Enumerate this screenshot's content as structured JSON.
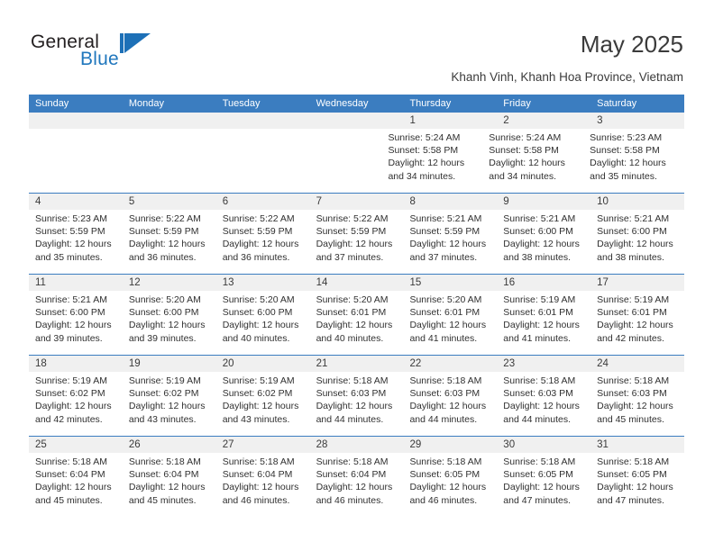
{
  "brand": {
    "name_part1": "General",
    "name_part2": "Blue",
    "accent_color": "#1d70b7",
    "logo_icon": "pennant-flag-icon"
  },
  "header": {
    "month_title": "May 2025",
    "location": "Khanh Vinh, Khanh Hoa Province, Vietnam"
  },
  "calendar": {
    "header_bg": "#3b7dc0",
    "date_band_bg": "#f0f0f0",
    "day_names": [
      "Sunday",
      "Monday",
      "Tuesday",
      "Wednesday",
      "Thursday",
      "Friday",
      "Saturday"
    ],
    "weeks": [
      {
        "days": [
          {
            "date": "",
            "empty": true
          },
          {
            "date": "",
            "empty": true
          },
          {
            "date": "",
            "empty": true
          },
          {
            "date": "",
            "empty": true
          },
          {
            "date": "1",
            "sunrise": "Sunrise: 5:24 AM",
            "sunset": "Sunset: 5:58 PM",
            "daylight": "Daylight: 12 hours and 34 minutes."
          },
          {
            "date": "2",
            "sunrise": "Sunrise: 5:24 AM",
            "sunset": "Sunset: 5:58 PM",
            "daylight": "Daylight: 12 hours and 34 minutes."
          },
          {
            "date": "3",
            "sunrise": "Sunrise: 5:23 AM",
            "sunset": "Sunset: 5:58 PM",
            "daylight": "Daylight: 12 hours and 35 minutes."
          }
        ]
      },
      {
        "days": [
          {
            "date": "4",
            "sunrise": "Sunrise: 5:23 AM",
            "sunset": "Sunset: 5:59 PM",
            "daylight": "Daylight: 12 hours and 35 minutes."
          },
          {
            "date": "5",
            "sunrise": "Sunrise: 5:22 AM",
            "sunset": "Sunset: 5:59 PM",
            "daylight": "Daylight: 12 hours and 36 minutes."
          },
          {
            "date": "6",
            "sunrise": "Sunrise: 5:22 AM",
            "sunset": "Sunset: 5:59 PM",
            "daylight": "Daylight: 12 hours and 36 minutes."
          },
          {
            "date": "7",
            "sunrise": "Sunrise: 5:22 AM",
            "sunset": "Sunset: 5:59 PM",
            "daylight": "Daylight: 12 hours and 37 minutes."
          },
          {
            "date": "8",
            "sunrise": "Sunrise: 5:21 AM",
            "sunset": "Sunset: 5:59 PM",
            "daylight": "Daylight: 12 hours and 37 minutes."
          },
          {
            "date": "9",
            "sunrise": "Sunrise: 5:21 AM",
            "sunset": "Sunset: 6:00 PM",
            "daylight": "Daylight: 12 hours and 38 minutes."
          },
          {
            "date": "10",
            "sunrise": "Sunrise: 5:21 AM",
            "sunset": "Sunset: 6:00 PM",
            "daylight": "Daylight: 12 hours and 38 minutes."
          }
        ]
      },
      {
        "days": [
          {
            "date": "11",
            "sunrise": "Sunrise: 5:21 AM",
            "sunset": "Sunset: 6:00 PM",
            "daylight": "Daylight: 12 hours and 39 minutes."
          },
          {
            "date": "12",
            "sunrise": "Sunrise: 5:20 AM",
            "sunset": "Sunset: 6:00 PM",
            "daylight": "Daylight: 12 hours and 39 minutes."
          },
          {
            "date": "13",
            "sunrise": "Sunrise: 5:20 AM",
            "sunset": "Sunset: 6:00 PM",
            "daylight": "Daylight: 12 hours and 40 minutes."
          },
          {
            "date": "14",
            "sunrise": "Sunrise: 5:20 AM",
            "sunset": "Sunset: 6:01 PM",
            "daylight": "Daylight: 12 hours and 40 minutes."
          },
          {
            "date": "15",
            "sunrise": "Sunrise: 5:20 AM",
            "sunset": "Sunset: 6:01 PM",
            "daylight": "Daylight: 12 hours and 41 minutes."
          },
          {
            "date": "16",
            "sunrise": "Sunrise: 5:19 AM",
            "sunset": "Sunset: 6:01 PM",
            "daylight": "Daylight: 12 hours and 41 minutes."
          },
          {
            "date": "17",
            "sunrise": "Sunrise: 5:19 AM",
            "sunset": "Sunset: 6:01 PM",
            "daylight": "Daylight: 12 hours and 42 minutes."
          }
        ]
      },
      {
        "days": [
          {
            "date": "18",
            "sunrise": "Sunrise: 5:19 AM",
            "sunset": "Sunset: 6:02 PM",
            "daylight": "Daylight: 12 hours and 42 minutes."
          },
          {
            "date": "19",
            "sunrise": "Sunrise: 5:19 AM",
            "sunset": "Sunset: 6:02 PM",
            "daylight": "Daylight: 12 hours and 43 minutes."
          },
          {
            "date": "20",
            "sunrise": "Sunrise: 5:19 AM",
            "sunset": "Sunset: 6:02 PM",
            "daylight": "Daylight: 12 hours and 43 minutes."
          },
          {
            "date": "21",
            "sunrise": "Sunrise: 5:18 AM",
            "sunset": "Sunset: 6:03 PM",
            "daylight": "Daylight: 12 hours and 44 minutes."
          },
          {
            "date": "22",
            "sunrise": "Sunrise: 5:18 AM",
            "sunset": "Sunset: 6:03 PM",
            "daylight": "Daylight: 12 hours and 44 minutes."
          },
          {
            "date": "23",
            "sunrise": "Sunrise: 5:18 AM",
            "sunset": "Sunset: 6:03 PM",
            "daylight": "Daylight: 12 hours and 44 minutes."
          },
          {
            "date": "24",
            "sunrise": "Sunrise: 5:18 AM",
            "sunset": "Sunset: 6:03 PM",
            "daylight": "Daylight: 12 hours and 45 minutes."
          }
        ]
      },
      {
        "days": [
          {
            "date": "25",
            "sunrise": "Sunrise: 5:18 AM",
            "sunset": "Sunset: 6:04 PM",
            "daylight": "Daylight: 12 hours and 45 minutes."
          },
          {
            "date": "26",
            "sunrise": "Sunrise: 5:18 AM",
            "sunset": "Sunset: 6:04 PM",
            "daylight": "Daylight: 12 hours and 45 minutes."
          },
          {
            "date": "27",
            "sunrise": "Sunrise: 5:18 AM",
            "sunset": "Sunset: 6:04 PM",
            "daylight": "Daylight: 12 hours and 46 minutes."
          },
          {
            "date": "28",
            "sunrise": "Sunrise: 5:18 AM",
            "sunset": "Sunset: 6:04 PM",
            "daylight": "Daylight: 12 hours and 46 minutes."
          },
          {
            "date": "29",
            "sunrise": "Sunrise: 5:18 AM",
            "sunset": "Sunset: 6:05 PM",
            "daylight": "Daylight: 12 hours and 46 minutes."
          },
          {
            "date": "30",
            "sunrise": "Sunrise: 5:18 AM",
            "sunset": "Sunset: 6:05 PM",
            "daylight": "Daylight: 12 hours and 47 minutes."
          },
          {
            "date": "31",
            "sunrise": "Sunrise: 5:18 AM",
            "sunset": "Sunset: 6:05 PM",
            "daylight": "Daylight: 12 hours and 47 minutes."
          }
        ]
      }
    ]
  }
}
